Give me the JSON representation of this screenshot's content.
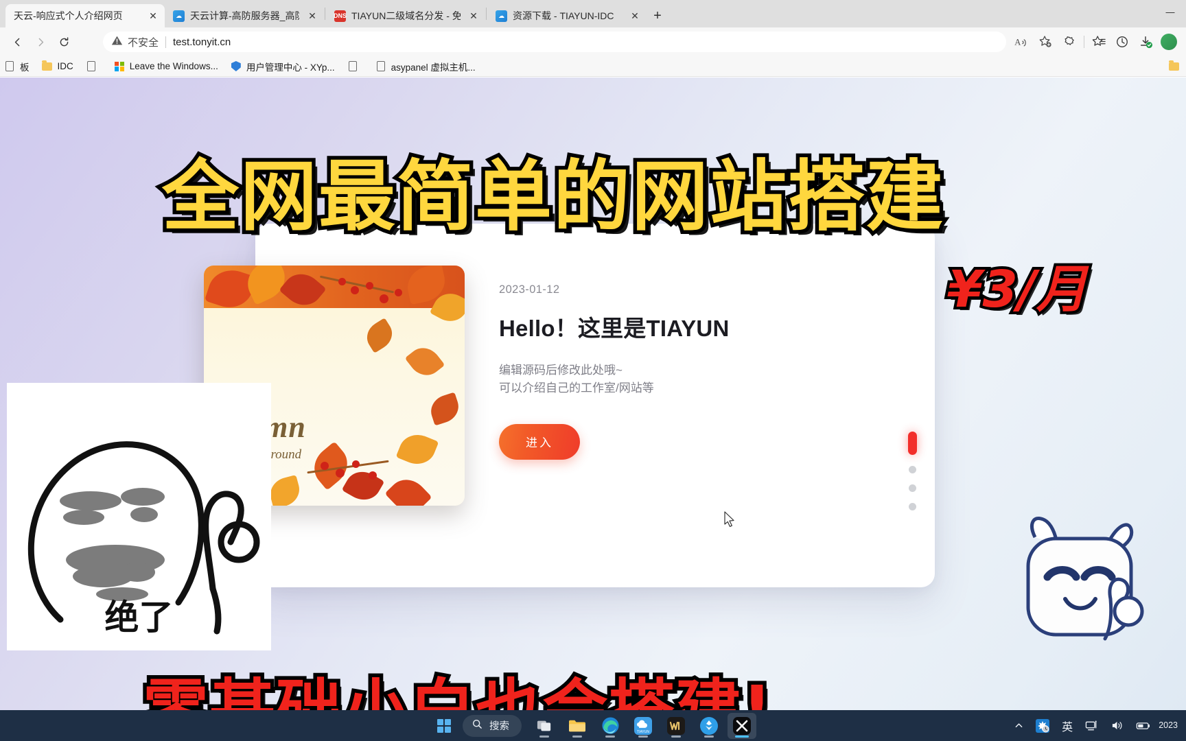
{
  "browser": {
    "tabs": [
      {
        "title": "天云-响应式个人介绍网页",
        "favicon": "none",
        "active": true
      },
      {
        "title": "天云计算-高防服务器_高防云主机",
        "favicon": "fav-blue",
        "active": false
      },
      {
        "title": "TIAYUN二级域名分发 - 免费二级",
        "favicon": "fav-red",
        "active": false
      },
      {
        "title": "资源下载 - TIAYUN-IDC",
        "favicon": "fav-blue",
        "active": false
      }
    ],
    "new_tab_label": "+",
    "close_label": "✕",
    "window_controls": {
      "minimize": "—",
      "maximize": "▢",
      "close": "✕"
    },
    "omnibox": {
      "security_label": "不安全",
      "url": "test.tonyit.cn",
      "warning_icon": "warning-triangle-icon"
    },
    "toolbar_icons": {
      "read_aloud": "read-aloud-icon",
      "add_favorite": "add-favorite-star-icon",
      "collections": "collections-icon",
      "favorites": "favorites-icon",
      "history": "history-icon",
      "downloads": "downloads-icon",
      "profile": "profile-avatar-icon"
    },
    "bookmarks": [
      {
        "label": "板",
        "icon": "page-icon"
      },
      {
        "label": "IDC",
        "icon": "folder-icon"
      },
      {
        "label": "",
        "icon": "page-icon"
      },
      {
        "label": "Leave the Windows...",
        "icon": "microsoft-icon"
      },
      {
        "label": "用户管理中心 - XYp...",
        "icon": "shield-icon"
      },
      {
        "label": "",
        "icon": "page-icon"
      },
      {
        "label": "asypanel 虚拟主机...",
        "icon": "page-icon"
      }
    ],
    "bookmarks_overflow_icon": "folder-icon"
  },
  "page": {
    "card": {
      "date": "2023-01-12",
      "title": "Hello！这里是TIAYUN",
      "desc_line1": "编辑源码后修改此处哦~",
      "desc_line2": "可以介绍自己的工作室/网站等",
      "button_label": "进入",
      "hero_image": {
        "alt": "autumn-leaves-illustration",
        "text_line1": "utumn",
        "text_line2": "Background"
      }
    },
    "pagination": {
      "total": 4,
      "active_index": 0
    }
  },
  "overlays": {
    "headline": "全网最简单的网站搭建",
    "headline_color": "#FFD73E",
    "price": "¥3/月",
    "price_color": "#F0231C",
    "bottom_text": "零基础小白也会搭建!",
    "bottom_text_color": "#F0231C",
    "meme_caption": "绝了",
    "meme_alt": "thumbs-up-meme-face",
    "mascot_alt": "capcut-mascot-sticker"
  },
  "taskbar": {
    "start_label": "start-button",
    "search_placeholder": "搜索",
    "apps": [
      {
        "name": "task-view",
        "label": "任务视图"
      },
      {
        "name": "file-explorer",
        "label": "文件资源管理器"
      },
      {
        "name": "microsoft-edge",
        "label": "Microsoft Edge"
      },
      {
        "name": "tiayun-app",
        "label": "TIAYUN"
      },
      {
        "name": "wps-office",
        "label": "WPS"
      },
      {
        "name": "blue-app",
        "label": "应用"
      },
      {
        "name": "capcut",
        "label": "剪映"
      }
    ],
    "tray": {
      "chevron": "▲",
      "ime_label": "英",
      "network_icon": "network-icon",
      "volume_icon": "volume-icon",
      "battery_icon": "battery-icon",
      "clock": "2023"
    }
  }
}
